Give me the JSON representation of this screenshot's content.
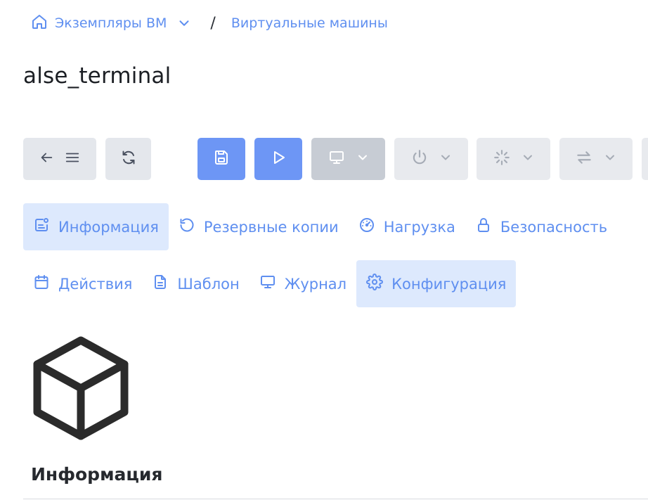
{
  "breadcrumb": {
    "parent_label": "Экземпляры ВМ",
    "separator": "/",
    "current_label": "Виртуальные машины"
  },
  "page": {
    "title": "alse_terminal"
  },
  "toolbar": {
    "icons": [
      "arrow-left-icon",
      "menu-icon",
      "refresh-icon",
      "save-icon",
      "play-icon",
      "monitor-icon",
      "power-icon",
      "loader-icon",
      "arrows-exchange-icon"
    ]
  },
  "tabs": [
    {
      "label": "Информация",
      "icon": "info-card-icon",
      "active": true
    },
    {
      "label": "Резервные копии",
      "icon": "history-icon",
      "active": false
    },
    {
      "label": "Нагрузка",
      "icon": "gauge-icon",
      "active": false
    },
    {
      "label": "Безопасность",
      "icon": "lock-icon",
      "active": false
    },
    {
      "label": "Действия",
      "icon": "calendar-icon",
      "active": false
    },
    {
      "label": "Шаблон",
      "icon": "document-icon",
      "active": false
    },
    {
      "label": "Журнал",
      "icon": "monitor-icon",
      "active": false
    },
    {
      "label": "Конфигурация",
      "icon": "gear-icon",
      "active": true
    }
  ],
  "section": {
    "title": "Информация",
    "icon": "cube-icon"
  },
  "colors": {
    "accent": "#5f8ff0",
    "primary_button": "#6d96f5",
    "active_tab_bg": "#dde9fd",
    "grey_button": "#e4e7ec"
  }
}
